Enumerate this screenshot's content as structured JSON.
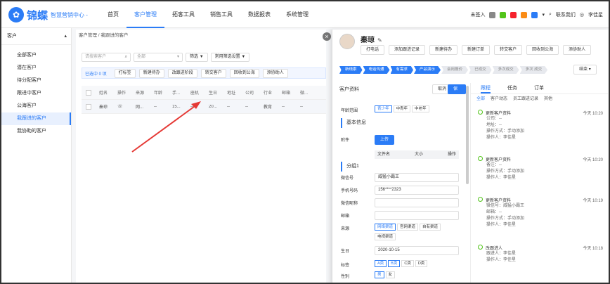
{
  "brand": {
    "logo": "锦蝶",
    "subtitle": "智慧营销中心 -"
  },
  "nav": [
    "首页",
    "客户管理",
    "拓客工具",
    "销售工具",
    "数据报表",
    "系统管理"
  ],
  "topright": {
    "signin": "未签入",
    "contact": "联系我们",
    "user": "李佳星"
  },
  "sidebar": {
    "title": "客户",
    "items": [
      "全部客户",
      "潜在客户",
      "待分配客户",
      "跟进中客户",
      "公海客户",
      "我跟进的客户",
      "我协助的客户"
    ]
  },
  "breadcrumb": {
    "root": "客户管理",
    "current": "我跟进的客户"
  },
  "filters": {
    "search_placeholder": "请搜索客户",
    "all": "全部",
    "filter": "筛选",
    "common": "常用筛选设置"
  },
  "actionbar": {
    "selected": "已选中 0 项",
    "actions": [
      "打标签",
      "新建待办",
      "改跟进阶段",
      "转交客户",
      "回收到公海",
      "添协助人"
    ]
  },
  "table": {
    "headers": [
      "姓名",
      "操作",
      "来源",
      "年龄",
      "手...",
      "座机",
      "生日",
      "地址",
      "公司",
      "行业",
      "邮箱",
      "微...",
      "渠道"
    ],
    "rows": [
      [
        "秦琼",
        "",
        "网...",
        "--",
        "15...",
        "--",
        "20...",
        "--",
        "--",
        "教育",
        "--",
        "--",
        "--"
      ]
    ]
  },
  "panel": {
    "name": "秦琼",
    "buttons": [
      "打电话",
      "添加跟进记录",
      "新建待办",
      "新建订单",
      "转交客户",
      "回收到公海",
      "添协助人"
    ],
    "stages": [
      "新线索",
      "电话沟通",
      "有需求",
      "产品演示",
      "会用报价",
      "已成交",
      "多次成交",
      "多次 成交"
    ],
    "stages_done": 4,
    "stage_end": "结束",
    "form": {
      "section1": "客户资料",
      "cancel": "取消",
      "save": "保存",
      "age_label": "年龄范围",
      "age_tags": [
        "青少年",
        "中青年",
        "中老年"
      ],
      "section2": "基本信息",
      "attach_label": "附件",
      "upload": "上传",
      "file_cols": [
        "文件名",
        "大小",
        "操作"
      ],
      "group": "分组1",
      "wechat_label": "微信号",
      "wechat": "威猛小霸王",
      "phone_label": "手机号码",
      "phone": "156****2323",
      "nick_label": "微信昵称",
      "mail_label": "邮箱",
      "source_label": "来源",
      "source_tags": [
        "网络渠道",
        "官网渠道",
        "自有渠道"
      ],
      "source_tag4": "电视渠道",
      "birth_label": "生日",
      "birth": "2020-10-15",
      "tag_label": "标签",
      "tags": [
        "A类",
        "B类",
        "C类",
        "D类"
      ],
      "gender_label": "性别",
      "gender": [
        "男",
        "女"
      ]
    },
    "right": {
      "tabs": [
        "跟程",
        "任务",
        "订单"
      ],
      "subtabs": [
        "全部",
        "客户动态",
        "员工跟进记录",
        "其他"
      ],
      "logs": [
        {
          "title": "更新客户资料",
          "time": "今天 10:20",
          "lines": [
            "公司：--",
            "地址：--",
            "操作方式：手动添加",
            "操作人：李佳星"
          ]
        },
        {
          "title": "更新客户资料",
          "time": "今天 10:20",
          "lines": [
            "备注：--",
            "操作方式：手动添加",
            "操作人：李佳星"
          ]
        },
        {
          "title": "更新客户资料",
          "time": "今天 10:19",
          "lines": [
            "微信号：威猛小霸王",
            "邮箱：--",
            "操作方式：手动添加",
            "操作人：李佳星"
          ]
        },
        {
          "title": "改跟进人",
          "time": "今天 10:18",
          "lines": [
            "跟进人：李佳星",
            "操作人：李佳星"
          ]
        }
      ]
    }
  }
}
